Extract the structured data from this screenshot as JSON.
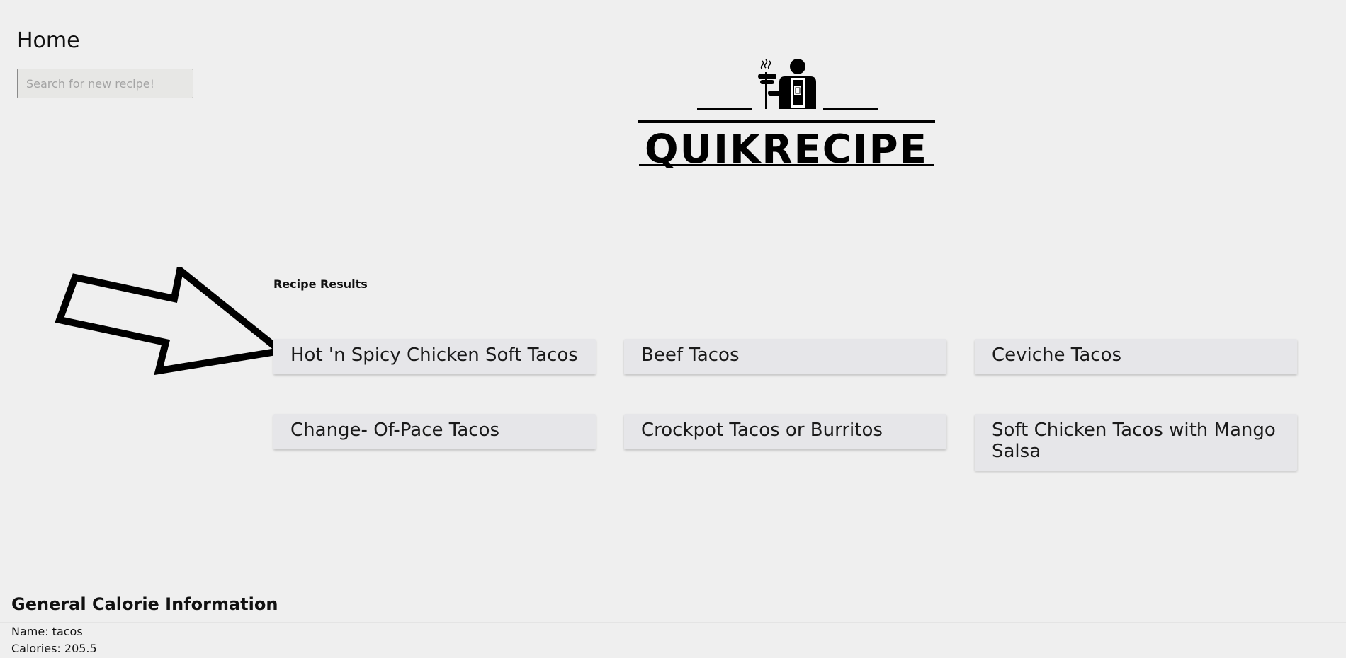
{
  "nav": {
    "home_label": "Home"
  },
  "search": {
    "placeholder": "Search for new recipe!",
    "value": ""
  },
  "logo": {
    "text": "QUIKRECIPE"
  },
  "results": {
    "heading": "Recipe Results",
    "items": [
      {
        "title": "Hot 'n Spicy Chicken Soft Tacos"
      },
      {
        "title": "Beef Tacos"
      },
      {
        "title": "Ceviche Tacos"
      },
      {
        "title": "Change- Of-Pace Tacos"
      },
      {
        "title": "Crockpot Tacos or Burritos"
      },
      {
        "title": "Soft Chicken Tacos with Mango Salsa"
      }
    ]
  },
  "calorie_info": {
    "heading": "General Calorie Information",
    "name_line": "Name: tacos",
    "calories_line": "Calories: 205.5"
  },
  "colors": {
    "background": "#efefef",
    "card": "#e6e6e9",
    "text": "#111111"
  }
}
